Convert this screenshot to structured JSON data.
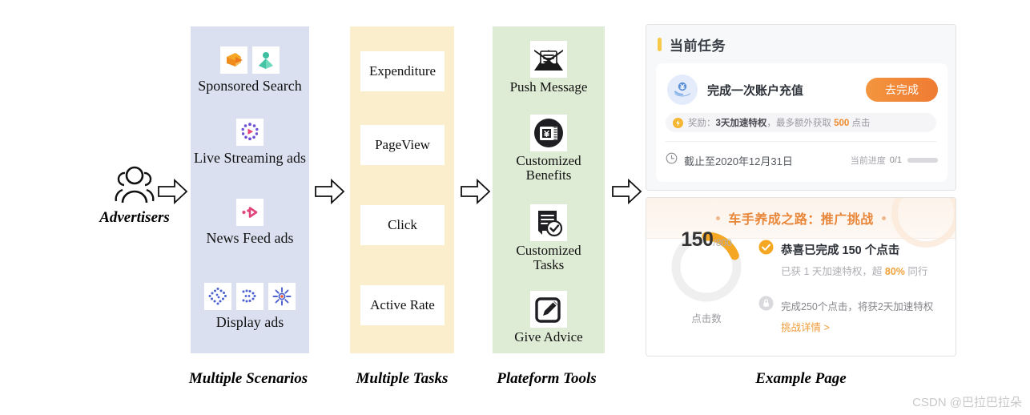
{
  "figure": {
    "advertisers_label": "Advertisers",
    "watermark": "CSDN @巴拉巴拉朵"
  },
  "captions": {
    "scenarios": "Multiple Scenarios",
    "tasks": "Multiple Tasks",
    "tools": "Plateform Tools",
    "example": "Example Page"
  },
  "scenarios": {
    "items": [
      {
        "label": "Sponsored Search",
        "icons": [
          "sponsored-search-orange-icon",
          "sponsored-search-green-icon"
        ]
      },
      {
        "label": "Live Streaming ads",
        "icons": [
          "live-streaming-icon"
        ]
      },
      {
        "label": "News Feed ads",
        "icons": [
          "news-feed-icon"
        ]
      },
      {
        "label": "Display ads",
        "icons": [
          "display-ads-diamond-icon",
          "display-ads-arrow-icon",
          "display-ads-burst-icon"
        ]
      }
    ]
  },
  "tasks": {
    "items": [
      {
        "label": "Expenditure"
      },
      {
        "label": "PageView"
      },
      {
        "label": "Click"
      },
      {
        "label": "Active Rate"
      }
    ]
  },
  "tools": {
    "items": [
      {
        "label": "Push Message",
        "icon": "envelope-icon"
      },
      {
        "label": "Customized\nBenefits",
        "icon": "coupon-yen-icon"
      },
      {
        "label": "Customized\nTasks",
        "icon": "checklist-icon"
      },
      {
        "label": "Give Advice",
        "icon": "pencil-square-icon"
      }
    ]
  },
  "example_page": {
    "current_task_card": {
      "title": "当前任务",
      "task_name": "完成一次账户充值",
      "cta_label": "去完成",
      "avatar_icon": "hand-holding-yen-icon",
      "reward": {
        "icon": "lightning-coin-icon",
        "prefix": "奖励：",
        "bold": "3天加速特权",
        "middle": "，最多额外获取 ",
        "highlight": "500",
        "suffix": " 点击"
      },
      "deadline_icon": "clock-icon",
      "deadline": "截止至2020年12月31日",
      "progress_label": "当前进度",
      "progress_value": "0/1"
    },
    "challenge_card": {
      "title": "车手养成之路：推广挑战",
      "ring": {
        "value": "150",
        "total": "/800",
        "caption": "点击数",
        "percent": 19
      },
      "done_icon": "check-circle-icon",
      "done_text": "恭喜已完成 150 个点击",
      "sub_prefix": "已获 1 天加速特权，超 ",
      "sub_highlight": "80%",
      "sub_suffix": " 同行",
      "next_icon": "lock-circle-icon",
      "next_text": "完成250个点击，将获2天加速特权",
      "link_text": "挑战详情 >"
    }
  },
  "colors": {
    "scenarios_bg": "#dbe0f0",
    "tasks_bg": "#fbeecd",
    "tools_bg": "#dfecd5",
    "accent_orange": "#ef7b33",
    "accent_yellow": "#f5b731"
  }
}
